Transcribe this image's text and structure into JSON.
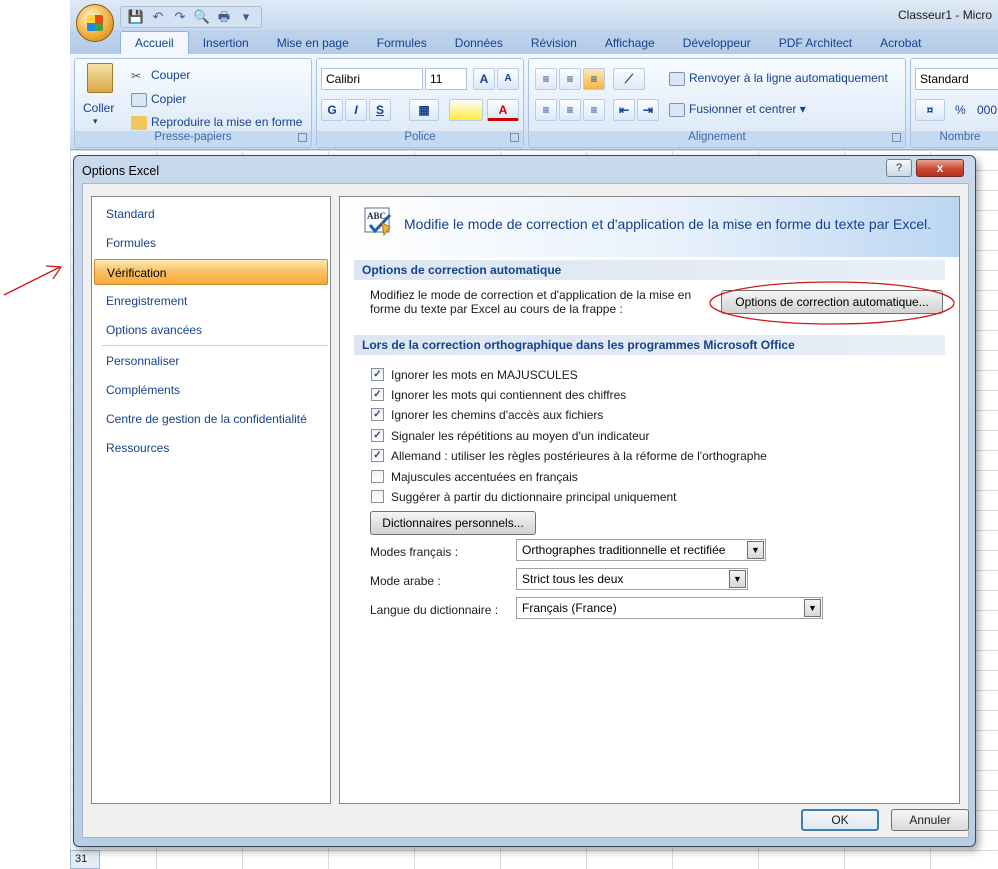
{
  "window": {
    "title": "Classeur1 - Micro"
  },
  "ribbon": {
    "tabs": [
      "Accueil",
      "Insertion",
      "Mise en page",
      "Formules",
      "Données",
      "Révision",
      "Affichage",
      "Développeur",
      "PDF Architect",
      "Acrobat"
    ],
    "clipboard": {
      "paste": "Coller",
      "cut": "Couper",
      "copy": "Copier",
      "format_painter": "Reproduire la mise en forme",
      "label": "Presse-papiers"
    },
    "font": {
      "name": "Calibri",
      "size": "11",
      "label": "Police",
      "bold": "G",
      "italic": "I",
      "underline": "S",
      "grow": "A",
      "shrink": "A",
      "color_letter": "A"
    },
    "alignment": {
      "wrap": "Renvoyer à la ligne automatiquement",
      "merge": "Fusionner et centrer",
      "label": "Alignement"
    },
    "number": {
      "format": "Standard",
      "percent": "%",
      "thousands": "000",
      "label": "Nombre"
    }
  },
  "sheet": {
    "row_header": "31"
  },
  "dialog": {
    "title": "Options Excel",
    "help": "?",
    "close": "x",
    "nav": [
      "Standard",
      "Formules",
      "Vérification",
      "Enregistrement",
      "Options avancées",
      "Personnaliser",
      "Compléments",
      "Centre de gestion de la confidentialité",
      "Ressources"
    ],
    "active_nav": "Vérification",
    "banner_icon": "ABC",
    "banner": "Modifie le mode de correction et d'application de la mise en forme du texte par Excel.",
    "autocorrect": {
      "header": "Options de correction automatique",
      "desc_line1": "Modifiez le mode de correction et d'application de la mise en",
      "desc_line2": "forme du texte par Excel au cours de la frappe :",
      "button": "Options de correction automatique..."
    },
    "spelling": {
      "header": "Lors de la correction orthographique dans les programmes Microsoft Office",
      "options": [
        {
          "label": "Ignorer les mots en MAJUSCULES",
          "checked": true
        },
        {
          "label": "Ignorer les mots qui contiennent des chiffres",
          "checked": true
        },
        {
          "label": "Ignorer les chemins d'accès aux fichiers",
          "checked": true
        },
        {
          "label": "Signaler les répétitions au moyen d'un indicateur",
          "checked": true
        },
        {
          "label": "Allemand : utiliser les règles postérieures à la réforme de l'orthographe",
          "checked": true
        },
        {
          "label": "Majuscules accentuées en français",
          "checked": false
        },
        {
          "label": "Suggérer à partir du dictionnaire principal uniquement",
          "checked": false
        }
      ],
      "custom_dict_button": "Dictionnaires personnels...",
      "french_modes_label": "Modes français :",
      "french_modes_value": "Orthographes traditionnelle et rectifiée",
      "arabic_mode_label": "Mode arabe :",
      "arabic_mode_value": "Strict tous les deux",
      "dict_lang_label": "Langue du dictionnaire :",
      "dict_lang_value": "Français (France)"
    },
    "ok": "OK",
    "cancel": "Annuler"
  },
  "annotation": {
    "color": "#d01818"
  }
}
